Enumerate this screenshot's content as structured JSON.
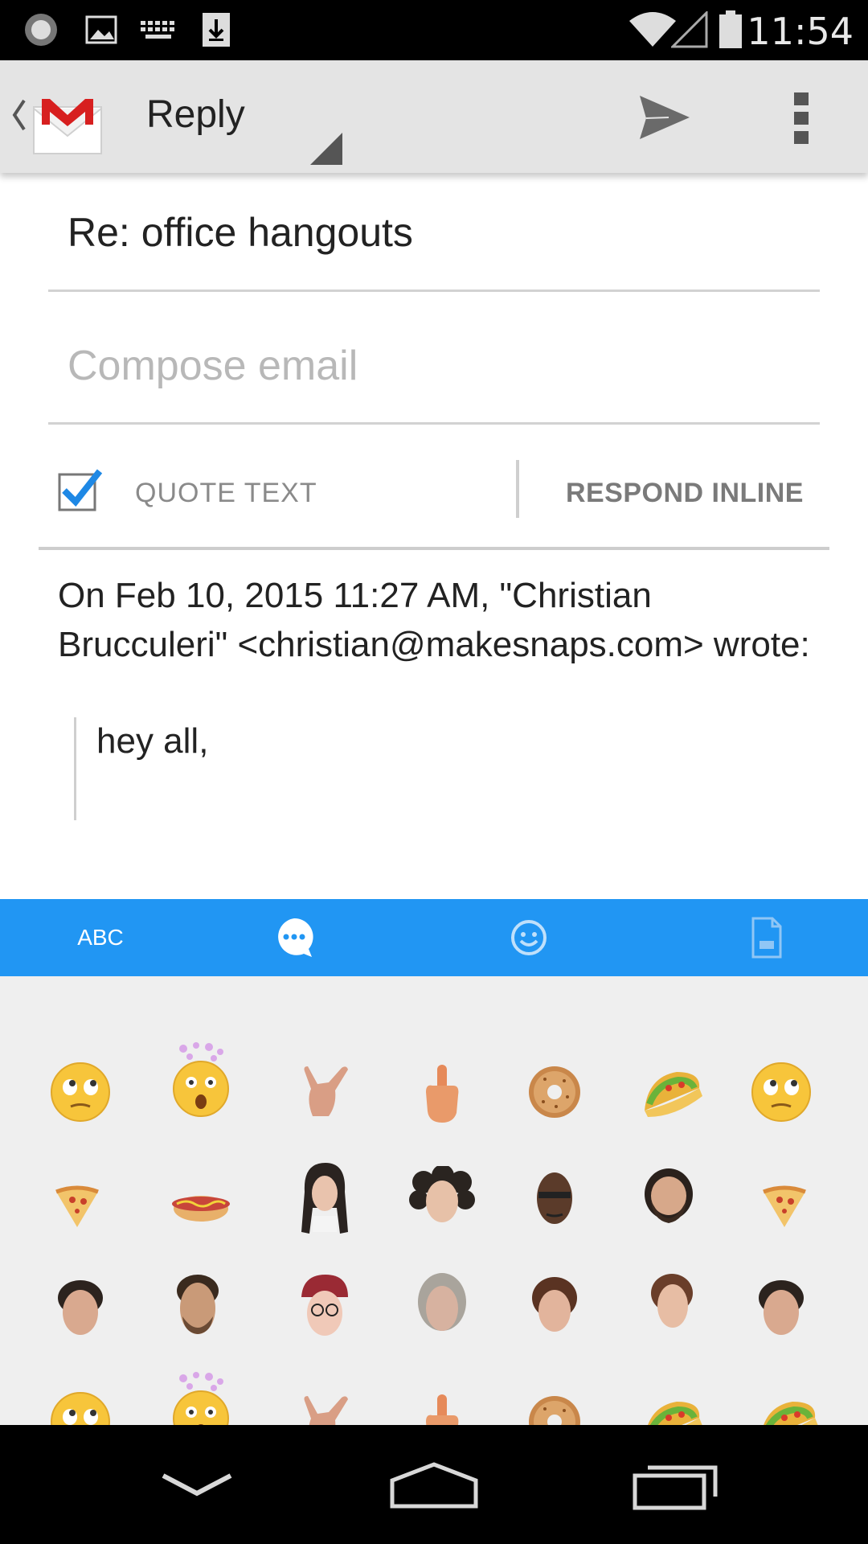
{
  "status_bar": {
    "time": "11:54",
    "icons": [
      "record-icon",
      "image-icon",
      "keyboard-icon",
      "download-icon",
      "wifi-icon",
      "signal-icon",
      "battery-icon"
    ]
  },
  "action_bar": {
    "title": "Reply",
    "icons": [
      "gmail-logo-icon",
      "send-icon",
      "overflow-menu-icon"
    ]
  },
  "compose": {
    "subject": "Re: office hangouts",
    "body_value": "",
    "body_placeholder": "Compose email",
    "quote_text_label": "QUOTE TEXT",
    "quote_text_checked": true,
    "respond_inline_label": "RESPOND INLINE"
  },
  "quoted": {
    "header": "On Feb 10, 2015 11:27 AM, \"Christian Brucculeri\" <christian@makesnaps.com> wrote:",
    "body": "hey all,"
  },
  "keyboard": {
    "tabs": [
      {
        "label": "ABC"
      },
      {
        "icon": "chat-bubble-icon"
      },
      {
        "icon": "smiley-icon"
      },
      {
        "icon": "gif-file-icon"
      }
    ],
    "accent_color": "#2196f3",
    "stickers": [
      [
        "eye-roll-emoji",
        "mind-blown-emoji",
        "shaka-hand-sticker",
        "middle-finger-sticker",
        "donut-sticker",
        "taco-sticker",
        "eye-roll-emoji"
      ],
      [
        "pizza-slice-sticker",
        "hot-dog-sticker",
        "woman-face-sticker",
        "curly-hair-face-sticker",
        "bald-man-face-sticker",
        "bearded-man-face-sticker",
        "pizza-slice-sticker"
      ],
      [
        "curly-boy-face-sticker",
        "stubble-man-face-sticker",
        "cap-glasses-face-sticker",
        "gray-hair-face-sticker",
        "woman-brown-hair-face-sticker",
        "woman-tilted-face-sticker",
        "curly-boy-face-sticker"
      ],
      [
        "eye-roll-emoji",
        "mind-blown-emoji",
        "shaka-hand-sticker",
        "middle-finger-sticker",
        "donut-sticker",
        "taco-sticker",
        "taco-sticker"
      ]
    ]
  },
  "nav_bar": {
    "icons": [
      "back-chevron-icon",
      "home-icon",
      "recent-apps-icon"
    ]
  }
}
